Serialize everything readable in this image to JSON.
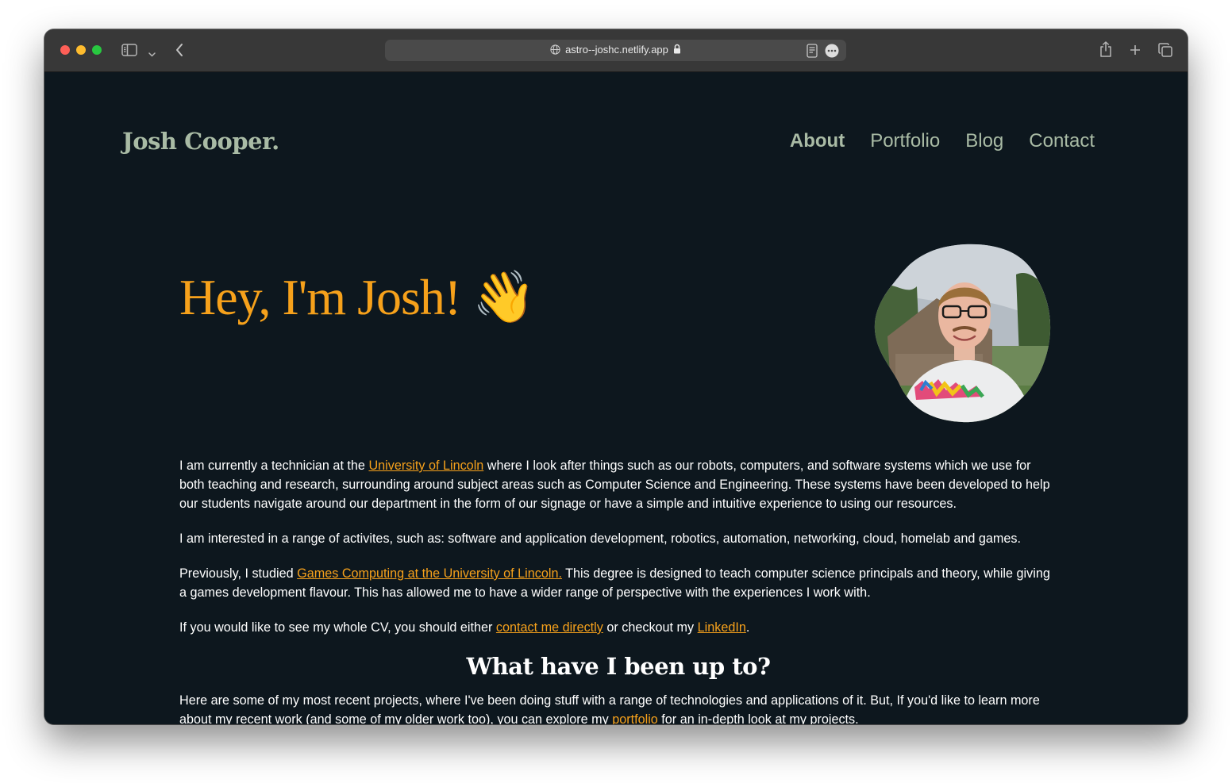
{
  "browser": {
    "url": "astro--joshc.netlify.app"
  },
  "site": {
    "logo": "Josh Cooper.",
    "nav": [
      {
        "label": "About"
      },
      {
        "label": "Portfolio"
      },
      {
        "label": "Blog"
      },
      {
        "label": "Contact"
      }
    ]
  },
  "hero": {
    "title": "Hey, I'm Josh! 👋"
  },
  "about": {
    "p1_pre": "I am currently a technician at the ",
    "p1_link": "University of Lincoln",
    "p1_post": " where I look after things such as our robots, computers, and software systems which we use for both teaching and research, surrounding around subject areas such as Computer Science and Engineering. These systems have been developed to help our students navigate around our department in the form of our signage or have a simple and intuitive experience to using our resources.",
    "p2": "I am interested in a range of activites, such as: software and application development, robotics, automation, networking, cloud, homelab and games.",
    "p3_pre": "Previously, I studied ",
    "p3_link": "Games Computing at the University of Lincoln.",
    "p3_post": " This degree is designed to teach computer science principals and theory, while giving a games development flavour. This has allowed me to have a wider range of perspective with the experiences I work with.",
    "p4_pre": "If you would like to see my whole CV, you should either ",
    "p4_link1": "contact me directly",
    "p4_mid": " or checkout my ",
    "p4_link2": "LinkedIn",
    "p4_post": "."
  },
  "recent": {
    "heading": "What have I been up to?",
    "p_pre": "Here are some of my most recent projects, where I've been doing stuff with a range of technologies and applications of it. But, If you'd like to learn more about my recent work (and some of my older work too), you can explore my ",
    "p_link": "portfolio",
    "p_post": " for an in-depth look at my projects."
  },
  "colors": {
    "background": "#0d171e",
    "accent": "#f6a11b",
    "nav_text": "#a9bba5",
    "body_text": "#ffffff"
  },
  "icons": [
    "sidebar-icon",
    "chevron-down-icon",
    "back-icon",
    "globe-icon",
    "lock-icon",
    "reader-icon",
    "more-icon",
    "share-icon",
    "new-tab-icon",
    "tabs-overview-icon"
  ]
}
